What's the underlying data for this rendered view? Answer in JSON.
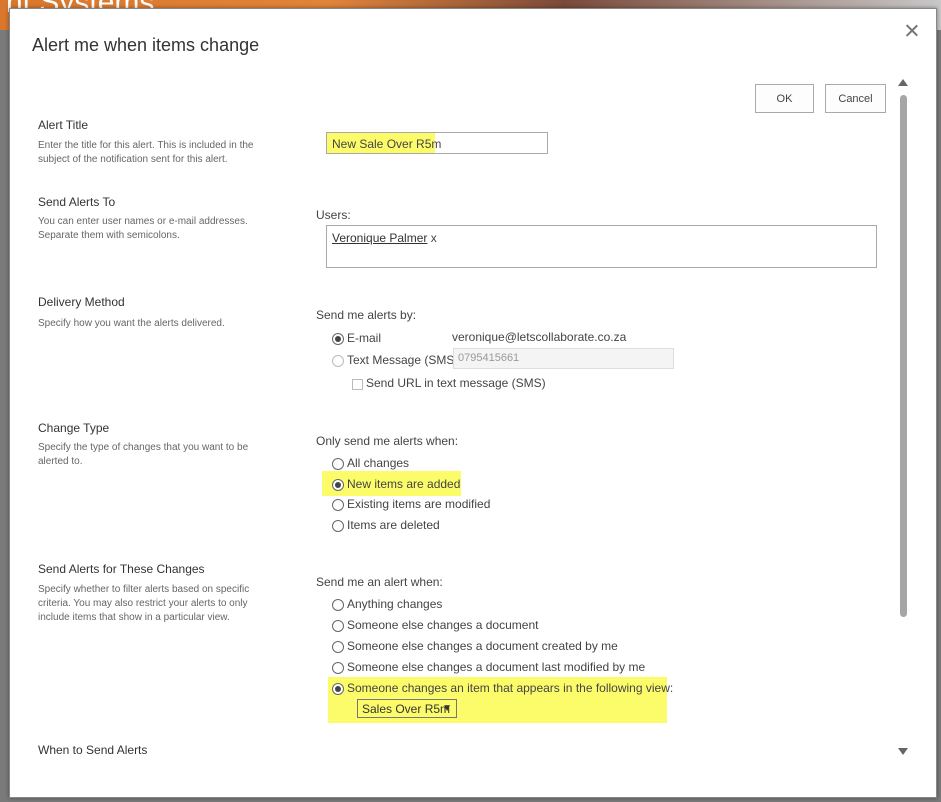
{
  "background": {
    "site_title": "nt Systems"
  },
  "dialog": {
    "title": "Alert me when items change",
    "ok_label": "OK",
    "cancel_label": "Cancel"
  },
  "alert_title": {
    "heading": "Alert Title",
    "description": "Enter the title for this alert. This is included in the subject of the notification sent for this alert.",
    "value": "New Sale Over R5m"
  },
  "send_to": {
    "heading": "Send Alerts To",
    "description": "You can enter user names or e-mail addresses. Separate them with semicolons.",
    "users_label": "Users:",
    "user": "Veronique Palmer",
    "remove": "x"
  },
  "delivery": {
    "heading": "Delivery Method",
    "description": "Specify how you want the alerts delivered.",
    "label": "Send me alerts by:",
    "email_label": "E-mail",
    "email_value": "veronique@letscollaborate.co.za",
    "sms_label": "Text Message (SMS)",
    "sms_value": "0795415661",
    "url_label": "Send URL in text message (SMS)"
  },
  "change_type": {
    "heading": "Change Type",
    "description": "Specify the type of changes that you want to be alerted to.",
    "label": "Only send me alerts when:",
    "options": [
      "All changes",
      "New items are added",
      "Existing items are modified",
      "Items are deleted"
    ],
    "selected": "New items are added"
  },
  "changes_filter": {
    "heading": "Send Alerts for These Changes",
    "description": "Specify whether to filter alerts based on specific criteria. You may also restrict your alerts to only include items that show in a particular view.",
    "label": "Send me an alert when:",
    "options": [
      "Anything changes",
      "Someone else changes a document",
      "Someone else changes a document created by me",
      "Someone else changes a document last modified by me",
      "Someone changes an item that appears in the following view:"
    ],
    "selected": "Someone changes an item that appears in the following view:",
    "view_value": "Sales Over R5m"
  },
  "when_to_send": {
    "heading": "When to Send Alerts"
  },
  "colors": {
    "highlight": "#fcfc6a"
  }
}
